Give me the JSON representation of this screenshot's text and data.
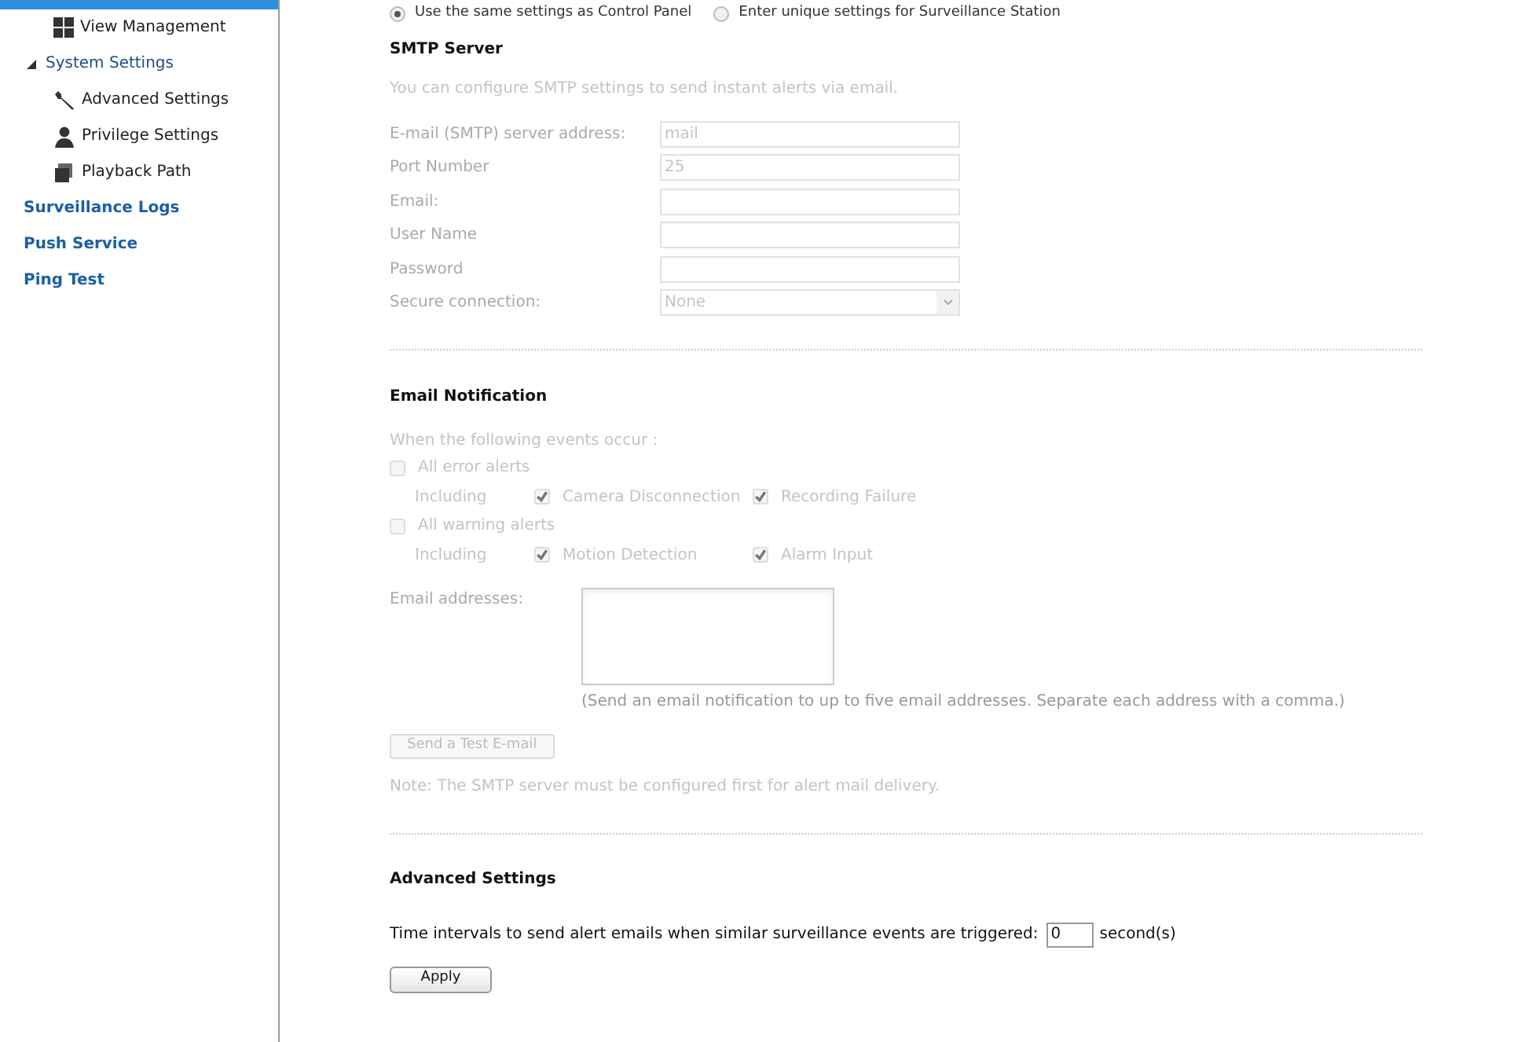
{
  "sidebar": {
    "items": [
      {
        "label": "View Management",
        "kind": "entry",
        "selected": false
      },
      {
        "label": "System Settings",
        "kind": "group",
        "selected": false,
        "expanded": true,
        "children": [
          {
            "label": "Advanced Settings",
            "kind": "entry",
            "selected": false
          },
          {
            "label": "Privilege Settings",
            "kind": "entry",
            "selected": false
          },
          {
            "label": "Playback Path",
            "kind": "entry",
            "selected": false
          }
        ]
      },
      {
        "label": "Surveillance Logs",
        "kind": "section",
        "selected": false
      },
      {
        "label": "Push Service",
        "kind": "section",
        "selected": false
      },
      {
        "label": "Ping Test",
        "kind": "section",
        "selected": false
      }
    ]
  },
  "source_options": [
    {
      "label": "Use the same settings as Control Panel",
      "selected": true
    },
    {
      "label": "Enter unique settings for Surveillance Station",
      "selected": false
    }
  ],
  "smtp": {
    "title": "SMTP Server",
    "description": "You can configure SMTP settings to send instant alerts via email.",
    "fields": [
      {
        "label": "E-mail (SMTP) server address:",
        "kind": "text",
        "value": "mail"
      },
      {
        "label": "Port Number",
        "kind": "text",
        "value": "25"
      },
      {
        "label": "Email:",
        "kind": "text"
      },
      {
        "label": "User Name",
        "kind": "text"
      },
      {
        "label": "Password",
        "kind": "text"
      },
      {
        "label": "Secure connection:",
        "kind": "select",
        "value": "None"
      }
    ]
  },
  "notification": {
    "title": "Email Notification",
    "intro": "When the following events occur :",
    "groups": [
      {
        "label": "All error alerts",
        "checked": false,
        "including": "Including",
        "items": [
          {
            "label": "Camera Disconnection",
            "checked": true
          },
          {
            "label": "Recording Failure",
            "checked": true
          }
        ]
      },
      {
        "label": "All warning alerts",
        "checked": false,
        "including": "Including",
        "items": [
          {
            "label": "Motion Detection",
            "checked": true
          },
          {
            "label": "Alarm Input",
            "checked": true
          }
        ]
      }
    ],
    "addresses_label": "Email addresses:",
    "addresses_hint": "(Send an email notification to up to five email addresses. Separate each address with a comma.)",
    "test_button": {
      "label": "Send a Test E-mail",
      "disabled": true
    },
    "note": "Note: The SMTP server must be configured first for alert mail delivery."
  },
  "advanced": {
    "title": "Advanced Settings",
    "interval_label": "Time intervals to send alert emails when similar surveillance events are triggered:",
    "interval_value": "0",
    "unit": "second(s)",
    "apply": "Apply"
  }
}
